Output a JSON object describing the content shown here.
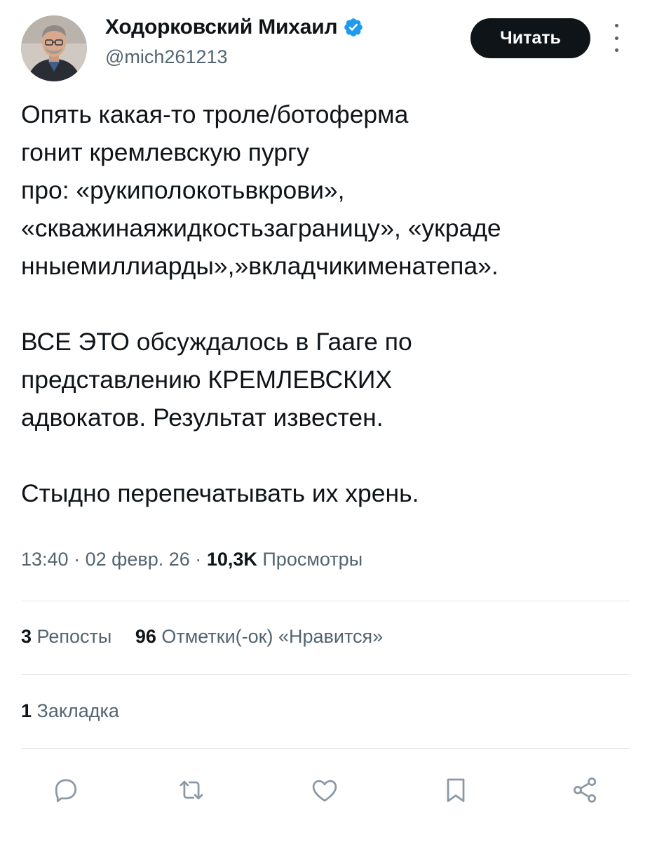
{
  "author": {
    "display_name": "Ходорковский Михаил",
    "handle": "@mich261213",
    "verified_icon": "verified-badge-icon",
    "accent_color": "#1d9bf0"
  },
  "follow_button": {
    "label": "Читать"
  },
  "more_menu": {
    "icon": "more-vertical-icon"
  },
  "tweet": {
    "lines_block1": [
      "Опять какая-то троле/ботоферма",
      "гонит кремлевскую пургу",
      "про: «рукиполокотьвкрови»,",
      "«скважинаяжидкостьзаграницу», «украде",
      "нныемиллиарды»,»вкладчикименатепа»."
    ],
    "lines_block2": [
      "ВСЕ ЭТО обсуждалось в Гааге по",
      "представлению КРЕМЛЕВСКИХ",
      "адвокатов. Результат известен."
    ],
    "lines_block3": [
      "Стыдно перепечатывать их хрень."
    ]
  },
  "meta": {
    "time": "13:40",
    "date": "02 февр. 26",
    "separator": "·",
    "views_count": "10,3K",
    "views_label": "Просмотры"
  },
  "stats": {
    "reposts_count": "3",
    "reposts_label": "Репосты",
    "likes_count": "96",
    "likes_label": "Отметки(-ок) «Нравится»",
    "bookmarks_count": "1",
    "bookmarks_label": "Закладка"
  },
  "actions": [
    {
      "name": "reply",
      "icon": "reply-icon"
    },
    {
      "name": "repost",
      "icon": "repost-icon"
    },
    {
      "name": "like",
      "icon": "heart-icon"
    },
    {
      "name": "bookmark",
      "icon": "bookmark-icon"
    },
    {
      "name": "share",
      "icon": "share-icon"
    }
  ],
  "colors": {
    "text_primary": "#0f1419",
    "text_secondary": "#536471",
    "divider": "#e1e6ea",
    "button_bg": "#0f1419",
    "icon_gray": "#8b98a5"
  }
}
